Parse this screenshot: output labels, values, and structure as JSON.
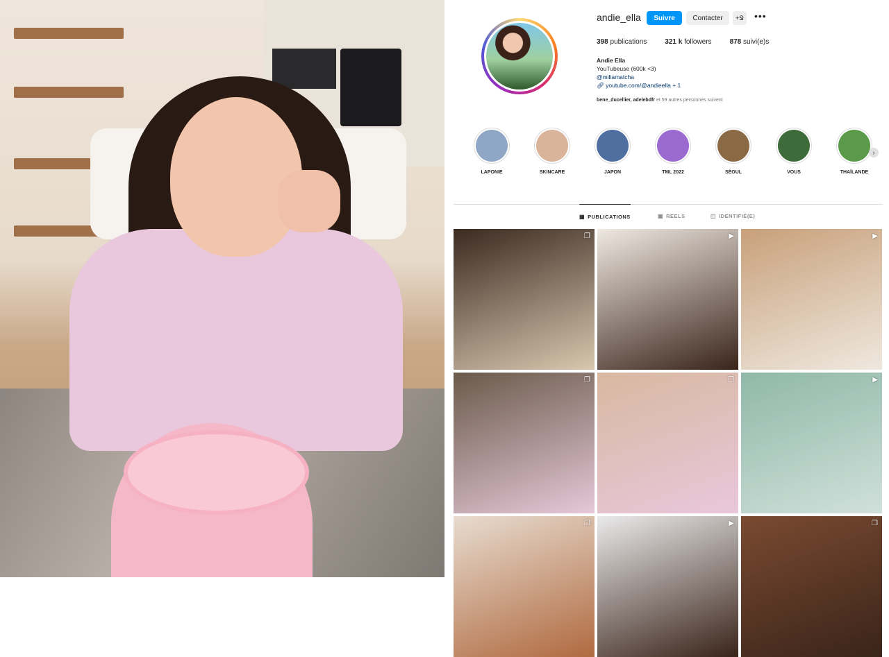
{
  "profile": {
    "username": "andie_ella",
    "follow_label": "Suivre",
    "contact_label": "Contacter",
    "add_user_label": "+Ջ",
    "more_label": "•••",
    "stats": {
      "posts_count": "398",
      "posts_label": "publications",
      "followers_count": "321 k",
      "followers_label": "followers",
      "following_count": "878",
      "following_label": "suivi(e)s"
    },
    "bio": {
      "name": "Andie Ella",
      "line1": "YouTubeuse (600k <3)",
      "mention": "@miliamatcha",
      "link": "youtube.com/@andieella + 1"
    },
    "followed_by": {
      "names": "bene_ducellier, adelebdfr",
      "rest": "et 59 autres personnes suivent"
    }
  },
  "highlights": [
    {
      "label": "LAPONIE",
      "color": "#8fa7c4"
    },
    {
      "label": "SKINCARE",
      "color": "#d9b39a"
    },
    {
      "label": "JAPON",
      "color": "#4f6fa0"
    },
    {
      "label": "TML 2022",
      "color": "#9a6ad0"
    },
    {
      "label": "SÉOUL",
      "color": "#8a6a45"
    },
    {
      "label": "VOUS",
      "color": "#3e6b3a"
    },
    {
      "label": "THAÏLANDE",
      "color": "#5a9a4a"
    }
  ],
  "tabs": [
    {
      "label": "PUBLICATIONS",
      "icon": "grid-icon",
      "active": true
    },
    {
      "label": "REELS",
      "icon": "reels-icon",
      "active": false
    },
    {
      "label": "IDENTIFIÉ(E)",
      "icon": "tagged-icon",
      "active": false
    }
  ],
  "posts": [
    {
      "type": "carousel",
      "colors": [
        "#3a2a20",
        "#d8c8b0"
      ]
    },
    {
      "type": "reel",
      "colors": [
        "#efe9e2",
        "#3a241a"
      ]
    },
    {
      "type": "reel",
      "colors": [
        "#c8a07a",
        "#efe8df"
      ]
    },
    {
      "type": "carousel",
      "colors": [
        "#6a5a4a",
        "#e6c8d8"
      ]
    },
    {
      "type": "carousel",
      "colors": [
        "#d8b8a0",
        "#e9c7dc"
      ]
    },
    {
      "type": "reel",
      "colors": [
        "#8fb8a8",
        "#d0e0da"
      ]
    },
    {
      "type": "carousel",
      "colors": [
        "#e8dcd0",
        "#b06a40"
      ]
    },
    {
      "type": "reel",
      "colors": [
        "#eaeaea",
        "#3a241a"
      ]
    },
    {
      "type": "carousel",
      "colors": [
        "#7a4a30",
        "#3a241a"
      ]
    }
  ]
}
